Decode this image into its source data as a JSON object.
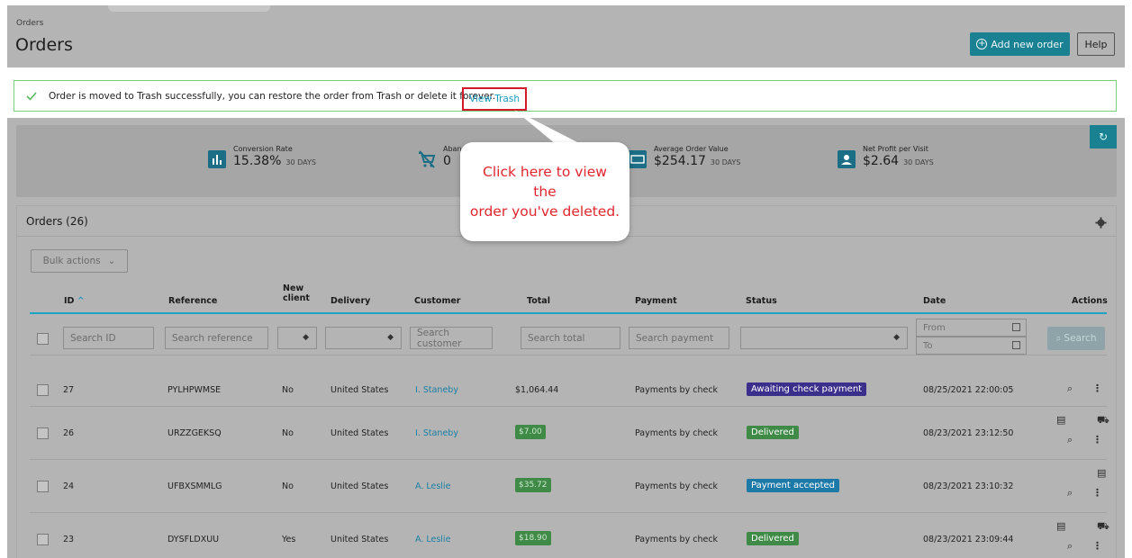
{
  "header": {
    "breadcrumb": "Orders",
    "title": "Orders",
    "add_button": "Add new order",
    "help_button": "Help"
  },
  "alert": {
    "message": "Order is moved to Trash successfully, you can restore the order from Trash or delete it forever.",
    "link": "View Trash"
  },
  "kpis": [
    {
      "label": "Conversion Rate",
      "value": "15.38%",
      "period": "30 DAYS",
      "icon": "chart-icon"
    },
    {
      "label": "Abandoned Carts",
      "value": "0",
      "period": "",
      "icon": "cart-icon"
    },
    {
      "label": "Average Order Value",
      "value": "$254.17",
      "period": "30 DAYS",
      "icon": "money-icon"
    },
    {
      "label": "Net Profit per Visit",
      "value": "$2.64",
      "period": "30 DAYS",
      "icon": "user-icon"
    }
  ],
  "panel": {
    "title": "Orders (26)",
    "bulk_actions": "Bulk actions"
  },
  "columns": {
    "id": "ID",
    "reference": "Reference",
    "new_client_1": "New",
    "new_client_2": "client",
    "delivery": "Delivery",
    "customer": "Customer",
    "total": "Total",
    "payment": "Payment",
    "status": "Status",
    "date": "Date",
    "actions": "Actions"
  },
  "filters": {
    "id": "Search ID",
    "reference": "Search reference",
    "customer": "Search customer",
    "total": "Search total",
    "payment": "Search payment",
    "date_from": "From",
    "date_to": "To",
    "search_button": "Search"
  },
  "rows": [
    {
      "id": "27",
      "reference": "PYLHPWMSE",
      "new_client": "No",
      "delivery": "United States",
      "customer": "I. Staneby",
      "total": "$1,064.44",
      "payment": "Payments by check",
      "status": "Awaiting check payment",
      "date": "08/25/2021 22:00:05"
    },
    {
      "id": "26",
      "reference": "URZZGEKSQ",
      "new_client": "No",
      "delivery": "United States",
      "customer": "I. Staneby",
      "total": "$7.00",
      "payment": "Payments by check",
      "status": "Delivered",
      "date": "08/23/2021 23:12:50"
    },
    {
      "id": "24",
      "reference": "UFBXSMMLG",
      "new_client": "No",
      "delivery": "United States",
      "customer": "A. Leslie",
      "total": "$35.72",
      "payment": "Payments by check",
      "status": "Payment accepted",
      "date": "08/23/2021 23:10:32"
    },
    {
      "id": "23",
      "reference": "DYSFLDXUU",
      "new_client": "Yes",
      "delivery": "United States",
      "customer": "A. Leslie",
      "total": "$18.90",
      "payment": "Payments by check",
      "status": "Delivered",
      "date": "08/23/2021 23:09:44"
    }
  ],
  "callout": {
    "line1": "Click here to view the",
    "line2": "order you've deleted."
  },
  "colors": {
    "accent": "#1a8193",
    "awaiting": "#3b2f8c",
    "delivered": "#3e8a46",
    "accepted": "#1d7aa8",
    "highlight": "#d11a2a"
  }
}
